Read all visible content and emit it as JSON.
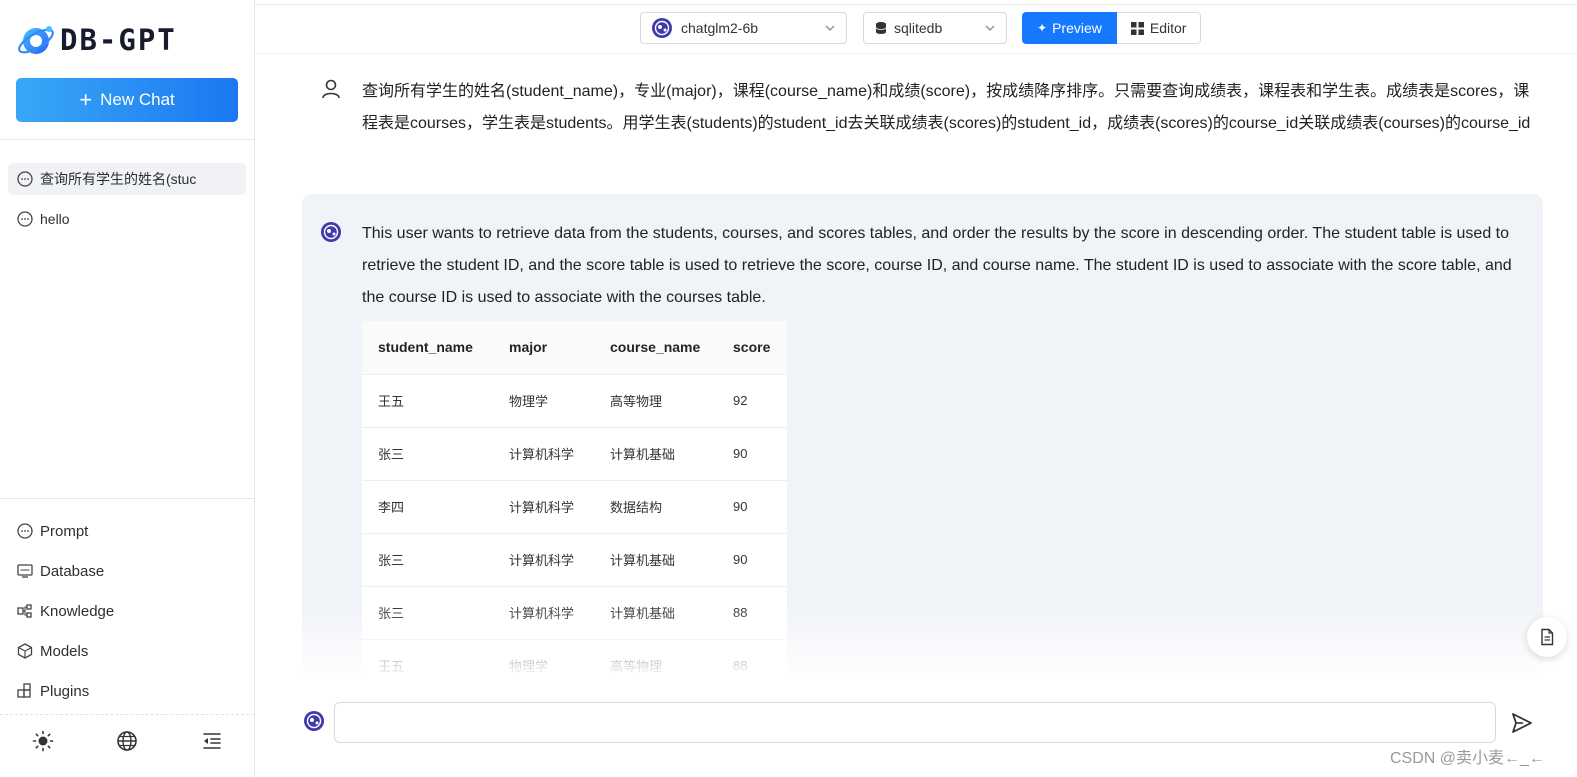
{
  "app": {
    "logo_text": "DB-GPT",
    "new_chat_label": "New Chat"
  },
  "sidebar": {
    "history": [
      {
        "label": "查询所有学生的姓名(stuc",
        "active": true
      },
      {
        "label": "hello",
        "active": false
      }
    ],
    "nav": [
      {
        "label": "Prompt",
        "icon": "chat-icon"
      },
      {
        "label": "Database",
        "icon": "database-icon"
      },
      {
        "label": "Knowledge",
        "icon": "knowledge-icon"
      },
      {
        "label": "Models",
        "icon": "cube-icon"
      },
      {
        "label": "Plugins",
        "icon": "plugins-icon"
      }
    ],
    "bottom_icons": [
      "sun-icon",
      "globe-icon",
      "collapse-menu-icon"
    ]
  },
  "toolbar": {
    "model_select": "chatglm2-6b",
    "db_select": "sqlitedb",
    "preview_label": "Preview",
    "editor_label": "Editor"
  },
  "conversation": {
    "user_message": "查询所有学生的姓名(student_name)，专业(major)，课程(course_name)和成绩(score)，按成绩降序排序。只需要查询成绩表，课程表和学生表。成绩表是scores，课程表是courses，学生表是students。用学生表(students)的student_id去关联成绩表(scores)的student_id，成绩表(scores)的course_id关联成绩表(courses)的course_id",
    "assistant_message": "This user wants to retrieve data from the students, courses, and scores tables, and order the results by the score in descending order. The student table is used to retrieve the student ID, and the score table is used to retrieve the score, course ID, and course name. The student ID is used to associate with the score table, and the course ID is used to associate with the courses table.",
    "table": {
      "columns": [
        "student_name",
        "major",
        "course_name",
        "score"
      ],
      "rows": [
        [
          "王五",
          "物理学",
          "高等物理",
          "92"
        ],
        [
          "张三",
          "计算机科学",
          "计算机基础",
          "90"
        ],
        [
          "李四",
          "计算机科学",
          "数据结构",
          "90"
        ],
        [
          "张三",
          "计算机科学",
          "计算机基础",
          "90"
        ],
        [
          "张三",
          "计算机科学",
          "计算机基础",
          "88"
        ],
        [
          "王五",
          "物理学",
          "高等物理",
          "88"
        ]
      ]
    }
  },
  "input": {
    "value": "",
    "placeholder": ""
  },
  "watermark": "CSDN @卖小麦←_←",
  "colors": {
    "accent": "#1677ff",
    "new_chat_gradient_start": "#39a7f6",
    "new_chat_gradient_end": "#1b78f2",
    "assistant_bg": "#f0f3f8",
    "logo_orb": "#2f7df6"
  }
}
